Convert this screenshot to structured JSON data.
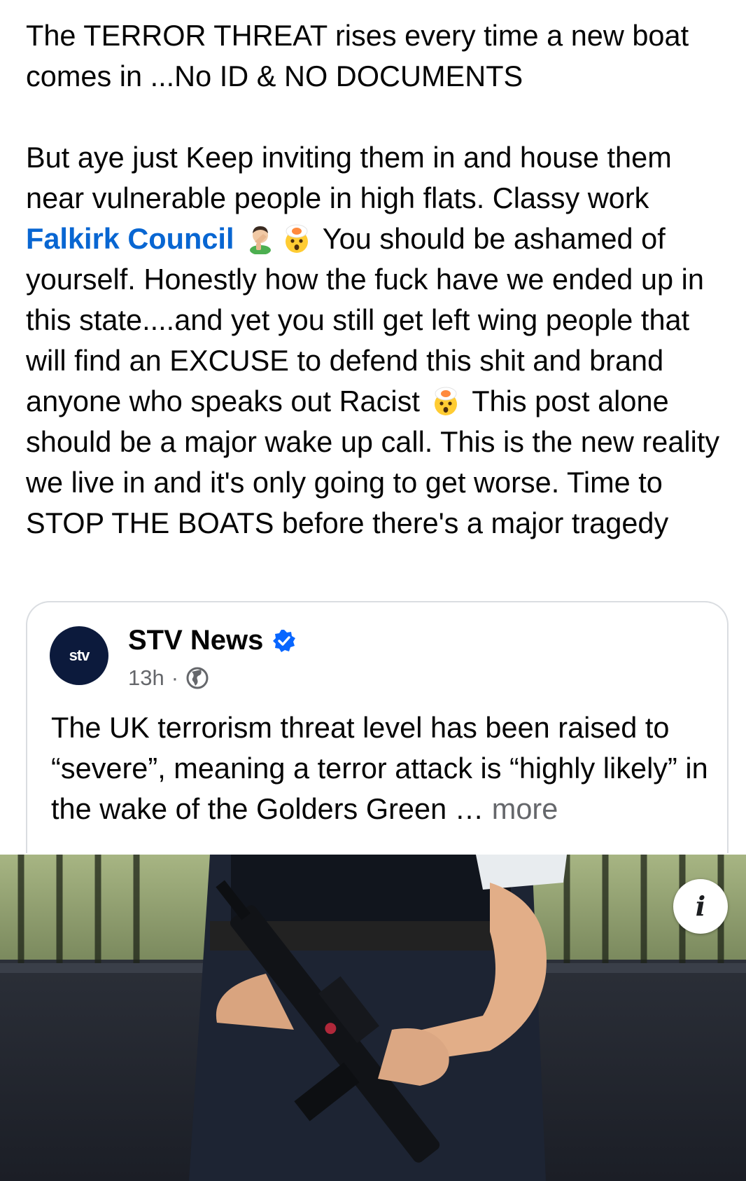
{
  "post": {
    "para1": "The TERROR THREAT rises every time a new boat comes in ...No ID & NO DOCUMENTS",
    "para2_start": "But aye just Keep inviting them in and house them near vulnerable people in high flats. Classy work ",
    "mention": "Falkirk Council",
    "para2_after_emoji": " You should be ashamed of yourself. Honestly how the fuck have we ended up in this state....and yet you still get left wing people that will find an EXCUSE to defend this shit and brand anyone who speaks out Racist ",
    "para2_end": " This post alone should be a major wake up call. This is the new reality we live in and it's only going to get worse. Time to STOP THE BOATS before there's a major tragedy",
    "emojis": [
      "man-facepalming-icon",
      "exploding-head-icon",
      "exploding-head-icon"
    ]
  },
  "shared_post": {
    "avatar_label": "stv",
    "page_name": "STV News",
    "verified": true,
    "time": "13h",
    "audience_icon": "globe-icon",
    "text": "The UK terrorism threat level has been raised to “severe”, meaning a terror attack is “highly likely” in the wake of the Golders Green ",
    "ellipsis": "…",
    "more_label": "more"
  },
  "photo": {
    "info_label": "i"
  },
  "colors": {
    "mention": "#0866d2",
    "verified": "#0866ff",
    "secondary_text": "#65676b",
    "stv_navy": "#0c1a3c"
  }
}
